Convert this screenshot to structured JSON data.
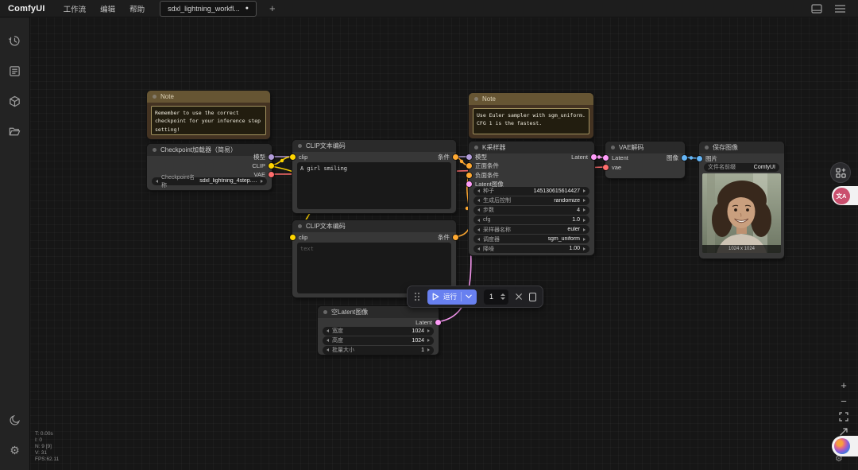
{
  "app": {
    "title": "ComfyUI",
    "menus": [
      "工作流",
      "编辑",
      "帮助"
    ],
    "tab": {
      "title": "sdxl_lightning_workfl...",
      "unsaved_dot": "●"
    }
  },
  "icons": {
    "plus": "+",
    "minus": "−",
    "gear": "⚙",
    "translate": "文A"
  },
  "stats": [
    "T: 0.00s",
    "I: 0",
    "N: 9 [9]",
    "V: 31",
    "FPS:62.11"
  ],
  "run_bar": {
    "run_label": "运行",
    "batch_count": "1"
  },
  "nodes": {
    "note_checkpoint": {
      "title": "Note",
      "text": "Remember to use the correct checkpoint for your inference step setting!"
    },
    "checkpoint_loader": {
      "title": "Checkpoint加载器（简易）",
      "outputs": [
        "模型",
        "CLIP",
        "VAE"
      ],
      "widget": {
        "label": "Checkpoint名称",
        "value": "sdxl_lightning_4step.saf..."
      }
    },
    "clip_positive": {
      "title": "CLIP文本编码",
      "input": "clip",
      "output": "条件",
      "text": "A girl smiling"
    },
    "clip_negative": {
      "title": "CLIP文本编码",
      "input": "clip",
      "output": "条件",
      "placeholder": "text"
    },
    "note_sampler": {
      "title": "Note",
      "text": "Use Euler sampler with sgm_uniform.\nCFG 1 is the fastest."
    },
    "ksampler": {
      "title": "K采样器",
      "inputs": [
        "模型",
        "正面条件",
        "负面条件",
        "Latent图像"
      ],
      "output": "Latent",
      "widgets": [
        {
          "label": "种子",
          "value": "145130615614427"
        },
        {
          "label": "生成后控制",
          "value": "randomize"
        },
        {
          "label": "步数",
          "value": "4"
        },
        {
          "label": "cfg",
          "value": "1.0"
        },
        {
          "label": "采样器名称",
          "value": "euler"
        },
        {
          "label": "调度器",
          "value": "sgm_uniform"
        },
        {
          "label": "降噪",
          "value": "1.00"
        }
      ]
    },
    "vae_decode": {
      "title": "VAE解码",
      "inputs": [
        "Latent",
        "vae"
      ],
      "output": "图像"
    },
    "save_image": {
      "title": "保存图像",
      "input": "图片",
      "widget": {
        "label": "文件名前缀",
        "value": "ComfyUI"
      },
      "caption": "1024 x 1024"
    },
    "empty_latent": {
      "title": "空Latent图像",
      "output": "Latent",
      "widgets": [
        {
          "label": "宽度",
          "value": "1024"
        },
        {
          "label": "高度",
          "value": "1024"
        },
        {
          "label": "批量大小",
          "value": "1"
        }
      ]
    }
  },
  "colors": {
    "accent": "#6880f0",
    "model": "#b39ddb",
    "clip": "#ffd500",
    "vae": "#ff6e6e",
    "conditioning": "#ffa931",
    "latent": "#ff9cf9",
    "image": "#64b5f6",
    "note-title": "#665533",
    "note-body": "#443322",
    "translate-badge": "#ca4f6e"
  }
}
